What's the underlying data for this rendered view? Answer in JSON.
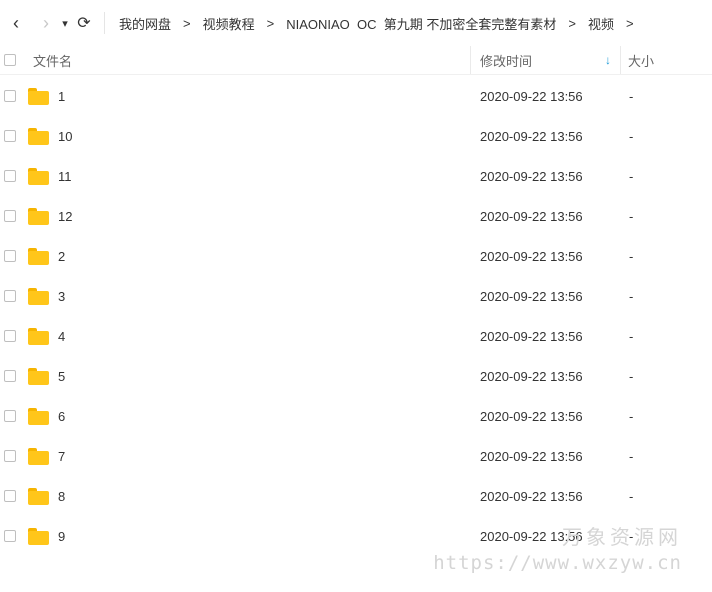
{
  "nav": {
    "back": "‹",
    "forward": "›",
    "dropdown": "▾",
    "refresh": "⟳"
  },
  "breadcrumb": {
    "items": [
      "我的网盘",
      "视频教程",
      "NIAONIAO  OC  第九期 不加密全套完整有素材",
      "视频"
    ],
    "separator": ">"
  },
  "header": {
    "name": "文件名",
    "modified": "修改时间",
    "size": "大小",
    "sort_icon": "↓"
  },
  "files": [
    {
      "name": "1",
      "modified": "2020-09-22 13:56",
      "size": "-"
    },
    {
      "name": "10",
      "modified": "2020-09-22 13:56",
      "size": "-"
    },
    {
      "name": "11",
      "modified": "2020-09-22 13:56",
      "size": "-"
    },
    {
      "name": "12",
      "modified": "2020-09-22 13:56",
      "size": "-"
    },
    {
      "name": "2",
      "modified": "2020-09-22 13:56",
      "size": "-"
    },
    {
      "name": "3",
      "modified": "2020-09-22 13:56",
      "size": "-"
    },
    {
      "name": "4",
      "modified": "2020-09-22 13:56",
      "size": "-"
    },
    {
      "name": "5",
      "modified": "2020-09-22 13:56",
      "size": "-"
    },
    {
      "name": "6",
      "modified": "2020-09-22 13:56",
      "size": "-"
    },
    {
      "name": "7",
      "modified": "2020-09-22 13:56",
      "size": "-"
    },
    {
      "name": "8",
      "modified": "2020-09-22 13:56",
      "size": "-"
    },
    {
      "name": "9",
      "modified": "2020-09-22 13:56",
      "size": "-"
    }
  ],
  "watermark": {
    "title": "万象资源网",
    "url": "https://www.wxzyw.cn"
  },
  "colors": {
    "folder": "#ffc61a",
    "sort_accent": "#1e9bd8"
  }
}
